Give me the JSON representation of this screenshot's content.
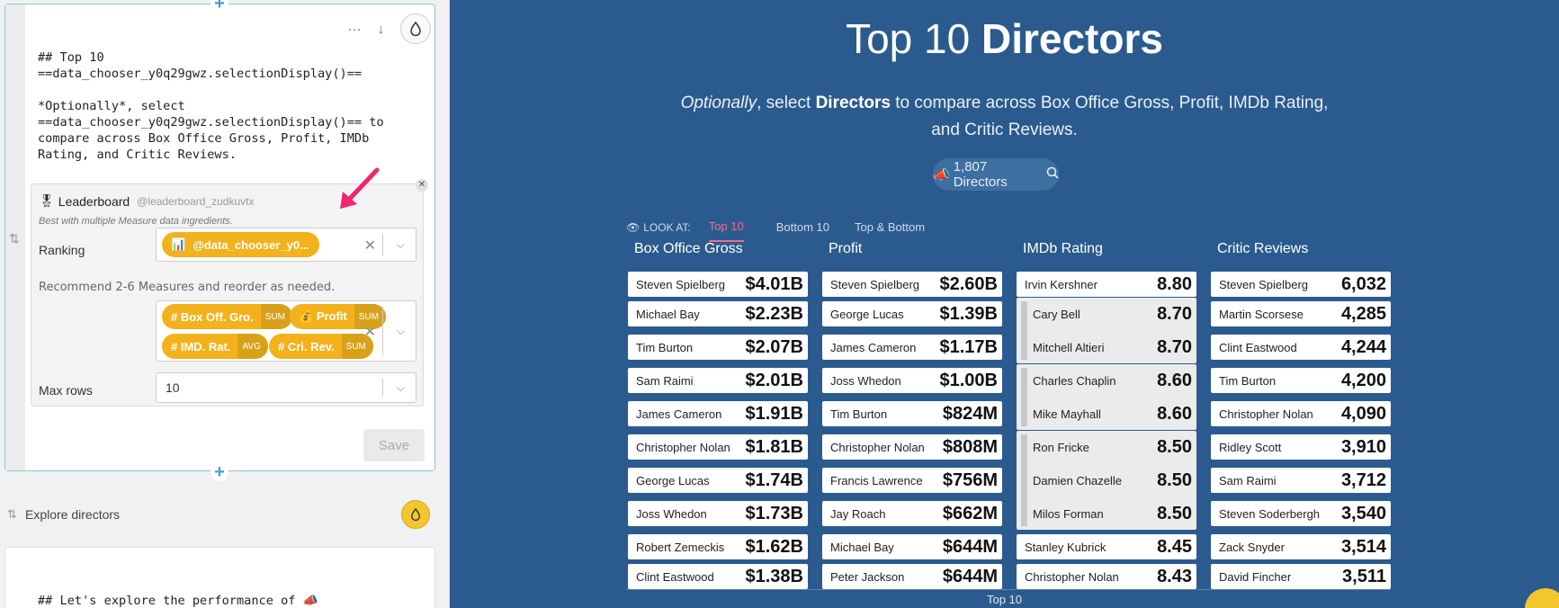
{
  "editor": {
    "card1_markdown": "## Top 10\n==data_chooser_y0q29gwz.selectionDisplay()==\n\n*Optionally*, select\n==data_chooser_y0q29gwz.selectionDisplay()== to\ncompare across Box Office Gross, Profit, IMDb\nRating, and Critic Reviews.",
    "widget": {
      "title": "Leaderboard",
      "handle": "@leaderboard_zudkuvtx",
      "note": "Best with multiple Measure data ingredients.",
      "ranking_label": "Ranking",
      "ranking_value": "@data_chooser_y0...",
      "recommend_text": "Recommend 2-6 Measures and reorder as needed.",
      "measures": [
        {
          "name": "Box Off. Gro.",
          "agg": "SUM",
          "icon": "hash-icon"
        },
        {
          "name": "Profit",
          "agg": "SUM",
          "icon": "money-bag-icon"
        },
        {
          "name": "IMD. Rat.",
          "agg": "AVG",
          "icon": "hash-icon"
        },
        {
          "name": "Cri. Rev.",
          "agg": "SUM",
          "icon": "hash-icon"
        }
      ],
      "max_rows_label": "Max rows",
      "max_rows_value": "10"
    },
    "save_label": "Save",
    "card2_title": "Explore directors",
    "card2_markdown": "## Let's explore the performance of 📣"
  },
  "preview": {
    "title_light": "Top 10 ",
    "title_bold": "Directors",
    "subtitle_em": "Optionally",
    "subtitle_mid": ", select ",
    "subtitle_bold": "Directors",
    "subtitle_rest": " to compare across Box Office Gross, Profit, IMDb Rating, and Critic Reviews.",
    "chooser_label": "1,807 Directors",
    "look_at_label": "LOOK AT:",
    "tabs": [
      "Top 10",
      "Bottom 10",
      "Top & Bottom"
    ],
    "active_tab": "Top 10",
    "footer_label": "Top 10",
    "accent_color": "#f36b8a",
    "background_color": "#2b5b8e"
  },
  "leaderboard": {
    "columns": [
      {
        "header": "Box Office Gross",
        "rows": [
          {
            "name": "Steven Spielberg",
            "value": "$4.01B"
          },
          {
            "name": "Michael Bay",
            "value": "$2.23B"
          },
          {
            "name": "Tim Burton",
            "value": "$2.07B"
          },
          {
            "name": "Sam Raimi",
            "value": "$2.01B"
          },
          {
            "name": "James Cameron",
            "value": "$1.91B"
          },
          {
            "name": "Christopher Nolan",
            "value": "$1.81B"
          },
          {
            "name": "George Lucas",
            "value": "$1.74B"
          },
          {
            "name": "Joss Whedon",
            "value": "$1.73B"
          },
          {
            "name": "Robert Zemeckis",
            "value": "$1.62B"
          },
          {
            "name": "Clint Eastwood",
            "value": "$1.38B"
          }
        ]
      },
      {
        "header": "Profit",
        "rows": [
          {
            "name": "Steven Spielberg",
            "value": "$2.60B"
          },
          {
            "name": "George Lucas",
            "value": "$1.39B"
          },
          {
            "name": "James Cameron",
            "value": "$1.17B"
          },
          {
            "name": "Joss Whedon",
            "value": "$1.00B"
          },
          {
            "name": "Tim Burton",
            "value": "$824M"
          },
          {
            "name": "Christopher Nolan",
            "value": "$808M"
          },
          {
            "name": "Francis Lawrence",
            "value": "$756M"
          },
          {
            "name": "Jay Roach",
            "value": "$662M"
          },
          {
            "name": "Michael Bay",
            "value": "$644M"
          },
          {
            "name": "Peter Jackson",
            "value": "$644M"
          }
        ]
      },
      {
        "header": "IMDb Rating",
        "rows": [
          {
            "name": "Irvin Kershner",
            "value": "8.80"
          },
          {
            "name": "Cary Bell",
            "value": "8.70"
          },
          {
            "name": "Mitchell Altieri",
            "value": "8.70"
          },
          {
            "name": "Charles Chaplin",
            "value": "8.60"
          },
          {
            "name": "Mike Mayhall",
            "value": "8.60"
          },
          {
            "name": "Ron Fricke",
            "value": "8.50"
          },
          {
            "name": "Damien Chazelle",
            "value": "8.50"
          },
          {
            "name": "Milos Forman",
            "value": "8.50"
          },
          {
            "name": "Stanley Kubrick",
            "value": "8.45"
          },
          {
            "name": "Christopher Nolan",
            "value": "8.43"
          }
        ]
      },
      {
        "header": "Critic Reviews",
        "rows": [
          {
            "name": "Steven Spielberg",
            "value": "6,032"
          },
          {
            "name": "Martin Scorsese",
            "value": "4,285"
          },
          {
            "name": "Clint Eastwood",
            "value": "4,244"
          },
          {
            "name": "Tim Burton",
            "value": "4,200"
          },
          {
            "name": "Christopher Nolan",
            "value": "4,090"
          },
          {
            "name": "Ridley Scott",
            "value": "3,910"
          },
          {
            "name": "Sam Raimi",
            "value": "3,712"
          },
          {
            "name": "Steven Soderbergh",
            "value": "3,540"
          },
          {
            "name": "Zack Snyder",
            "value": "3,514"
          },
          {
            "name": "David Fincher",
            "value": "3,511"
          }
        ]
      }
    ]
  }
}
